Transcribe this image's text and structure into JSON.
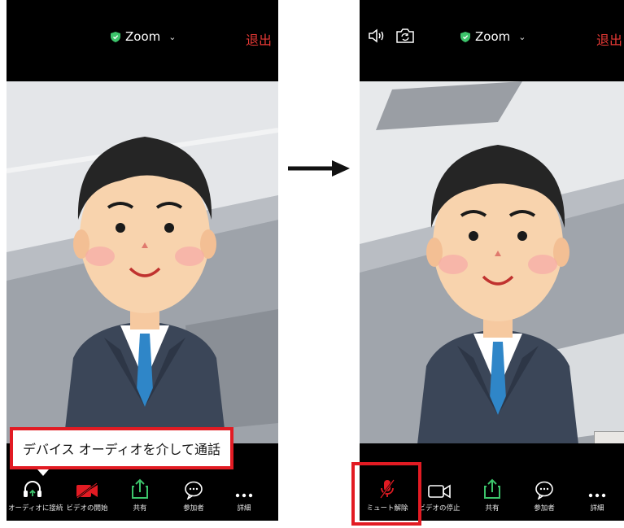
{
  "left_phone": {
    "meeting_title": "Zoom",
    "leave_label": "退出",
    "tooltip_text": "デバイス オーディオを介して通話",
    "toolbar": [
      {
        "label": "オーディオに接続",
        "icon": "headphones-icon"
      },
      {
        "label": "ビデオの開始",
        "icon": "video-off-icon"
      },
      {
        "label": "共有",
        "icon": "share-icon"
      },
      {
        "label": "参加者",
        "icon": "participants-icon"
      },
      {
        "label": "詳細",
        "icon": "more-icon"
      }
    ]
  },
  "right_phone": {
    "meeting_title": "Zoom",
    "leave_label": "退出",
    "toolbar": [
      {
        "label": "ミュート解除",
        "icon": "mic-muted-icon"
      },
      {
        "label": "ビデオの停止",
        "icon": "video-icon"
      },
      {
        "label": "共有",
        "icon": "share-icon"
      },
      {
        "label": "参加者",
        "icon": "participants-icon"
      },
      {
        "label": "詳細",
        "icon": "more-icon"
      }
    ]
  },
  "colors": {
    "accent_red": "#e21b23",
    "leave_red": "#e53935",
    "shield_green": "#3cc46b",
    "share_green": "#3cc46b"
  }
}
